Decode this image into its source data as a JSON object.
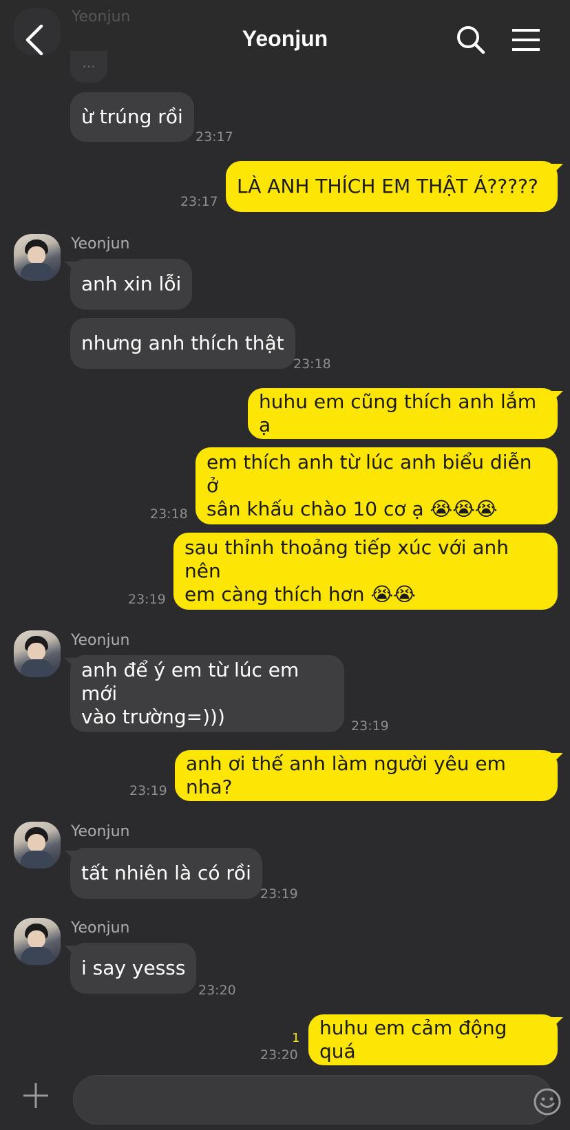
{
  "header": {
    "title": "Yeonjun",
    "ghost_name": "Yeonjun",
    "ghost_bubble": "..."
  },
  "colors": {
    "background": "#2b2b2d",
    "incoming_bubble": "#3e3e40",
    "outgoing_bubble": "#fde505",
    "timestamp": "#8e8e90"
  },
  "messages": [
    {
      "dir": "in",
      "text": "ừ trúng rồi",
      "time": "23:17"
    },
    {
      "dir": "out",
      "text": "LÀ ANH THÍCH EM THẬT Á?????",
      "time": "23:17"
    },
    {
      "dir": "in",
      "sender": "Yeonjun",
      "text": "anh xin lỗi"
    },
    {
      "dir": "in",
      "text": "nhưng anh thích thật",
      "time": "23:18"
    },
    {
      "dir": "out",
      "text": "huhu em cũng thích anh lắm ạ"
    },
    {
      "dir": "out",
      "text": "em thích anh từ lúc anh biểu diễn ở\nsân khấu chào 10 cơ ạ 😭😭😭",
      "time": "23:18"
    },
    {
      "dir": "out",
      "text": "sau thỉnh thoảng tiếp xúc với anh nên\nem càng thích hơn 😭😭",
      "time": "23:19"
    },
    {
      "dir": "in",
      "sender": "Yeonjun",
      "text": "anh để ý em từ lúc em mới\nvào trường=)))",
      "time": "23:19"
    },
    {
      "dir": "out",
      "text": "anh ơi thế anh làm người yêu em nha?",
      "time": "23:19"
    },
    {
      "dir": "in",
      "sender": "Yeonjun",
      "text": "tất nhiên là có rồi",
      "time": "23:19"
    },
    {
      "dir": "in",
      "sender": "Yeonjun",
      "text": "i say yesss",
      "time": "23:20"
    },
    {
      "dir": "out",
      "text": "huhu em cảm động quá",
      "time": "23:20",
      "unread": "1"
    }
  ],
  "icons": {
    "back": "chevron-left-icon",
    "search": "search-icon",
    "menu": "hamburger-menu-icon",
    "plus": "plus-icon",
    "emoji": "smiley-icon",
    "hash": "hashtag-icon"
  }
}
